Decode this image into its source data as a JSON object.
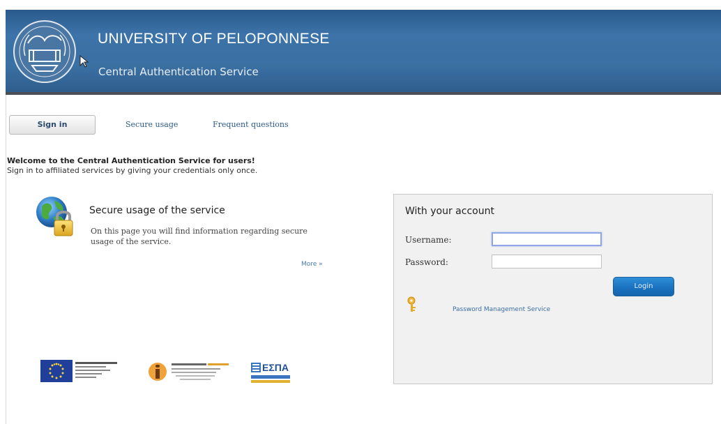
{
  "header": {
    "title": "UNIVERSITY OF PELOPONNESE",
    "subtitle": "Central Authentication Service"
  },
  "nav": {
    "tabs": [
      {
        "label": "Sign in",
        "active": true
      },
      {
        "label": "Secure usage",
        "active": false
      },
      {
        "label": "Frequent questions",
        "active": false
      }
    ]
  },
  "welcome": {
    "headline": "Welcome to the Central Authentication Service for users!",
    "subline": "Sign in to affiliated services by giving your credentials only once."
  },
  "secure_section": {
    "icon": "globe-lock-icon",
    "title": "Secure usage of the service",
    "text": "On this page you will find information regarding secure usage of the service.",
    "more_link": "More »"
  },
  "login": {
    "title": "With your account",
    "username_label": "Username:",
    "username_value": "",
    "password_label": "Password:",
    "password_value": "",
    "button_label": "Login",
    "password_service_link": "Password Management Service"
  },
  "colors": {
    "header_bg": "#3a6fa2",
    "link": "#2b5a86",
    "button": "#1a72c0",
    "login_box_bg": "#f1f1f1"
  }
}
